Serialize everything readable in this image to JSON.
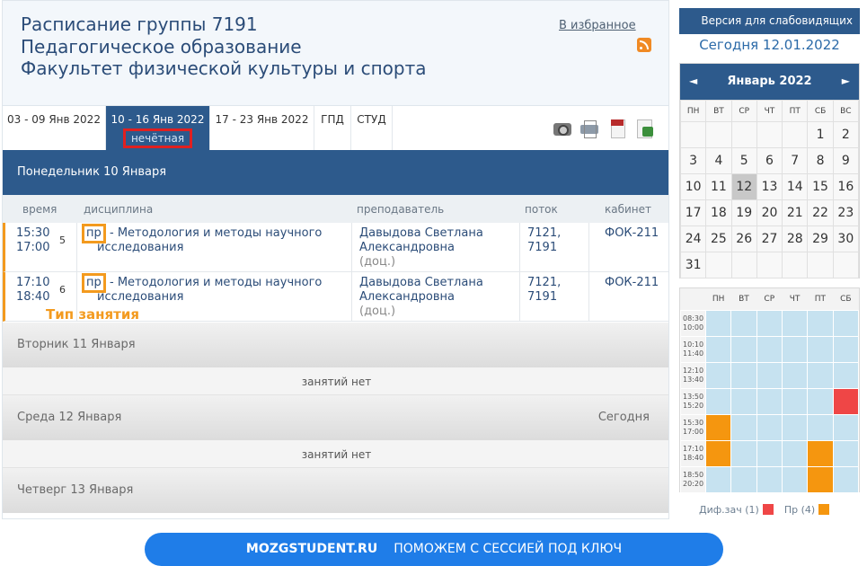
{
  "header": {
    "title_line1": "Расписание группы 7191",
    "title_line2": "Педагогическое образование",
    "title_line3": "Факультет физической культуры и спорта",
    "favorites_link": "В избранное"
  },
  "weeks": {
    "tabs": [
      {
        "label": "03 - 09 Янв 2022"
      },
      {
        "label": "10 - 16 Янв 2022"
      },
      {
        "label": "17 - 23 Янв 2022"
      },
      {
        "label": "ГПД"
      },
      {
        "label": "СТУД"
      }
    ],
    "active_parity": "нечётная"
  },
  "columns": {
    "time": "время",
    "discipline": "дисциплина",
    "teacher": "преподаватель",
    "stream": "поток",
    "room": "кабинет"
  },
  "days": {
    "monday": "Понедельник 10 Января",
    "tuesday": "Вторник 11 Января",
    "wednesday": "Среда 12 Января",
    "wednesday_today": "Сегодня",
    "thursday": "Четверг 13 Января",
    "no_lessons": "занятий нет"
  },
  "lessons": [
    {
      "start": "15:30",
      "end": "17:00",
      "num": "5",
      "type": "пр",
      "discipline": "- Методология и методы научного исследования",
      "teacher_line1": "Давыдова Светлана",
      "teacher_line2": "Александровна",
      "rank": "(доц.)",
      "stream_line1": "7121,",
      "stream_line2": "7191",
      "room": "ФОК-211"
    },
    {
      "start": "17:10",
      "end": "18:40",
      "num": "6",
      "type": "пр",
      "discipline": "- Методология и методы научного исследования",
      "teacher_line1": "Давыдова Светлана",
      "teacher_line2": "Александровна",
      "rank": "(доц.)",
      "stream_line1": "7121,",
      "stream_line2": "7191",
      "room": "ФОК-211"
    }
  ],
  "annotation": "Тип занятия",
  "sidebar": {
    "vision_button": "Версия для слабовидящих",
    "today": "Сегодня 12.01.2022",
    "calendar": {
      "month": "Январь 2022",
      "prev": "◄",
      "next": "►",
      "weekdays": [
        "ПН",
        "ВТ",
        "СР",
        "ЧТ",
        "ПТ",
        "СБ",
        "ВС"
      ],
      "today_day": "12",
      "weeks": [
        [
          "",
          "",
          "",
          "",
          "",
          "1",
          "2"
        ],
        [
          "3",
          "4",
          "5",
          "6",
          "7",
          "8",
          "9"
        ],
        [
          "10",
          "11",
          "12",
          "13",
          "14",
          "15",
          "16"
        ],
        [
          "17",
          "18",
          "19",
          "20",
          "21",
          "22",
          "23"
        ],
        [
          "24",
          "25",
          "26",
          "27",
          "28",
          "29",
          "30"
        ],
        [
          "31",
          "",
          "",
          "",
          "",
          "",
          ""
        ]
      ]
    },
    "week_grid": {
      "days": [
        "ПН",
        "ВТ",
        "СР",
        "ЧТ",
        "ПТ",
        "СБ"
      ],
      "slots": [
        {
          "from": "08:30",
          "to": "10:00",
          "cells": [
            "",
            "",
            "",
            "",
            "",
            ""
          ]
        },
        {
          "from": "10:10",
          "to": "11:40",
          "cells": [
            "",
            "",
            "",
            "",
            "",
            ""
          ]
        },
        {
          "from": "12:10",
          "to": "13:40",
          "cells": [
            "",
            "",
            "",
            "",
            "",
            ""
          ]
        },
        {
          "from": "13:50",
          "to": "15:20",
          "cells": [
            "",
            "",
            "",
            "",
            "",
            "dz"
          ]
        },
        {
          "from": "15:30",
          "to": "17:00",
          "cells": [
            "pr",
            "",
            "",
            "",
            "",
            ""
          ]
        },
        {
          "from": "17:10",
          "to": "18:40",
          "cells": [
            "pr",
            "",
            "",
            "",
            "pr",
            ""
          ]
        },
        {
          "from": "18:50",
          "to": "20:20",
          "cells": [
            "",
            "",
            "",
            "",
            "pr",
            ""
          ]
        }
      ],
      "legend": [
        {
          "label": "Диф.зач (1)",
          "color": "#ef4646"
        },
        {
          "label": "Пр (4)",
          "color": "#f5960f"
        }
      ]
    }
  },
  "banner": {
    "brand": "MOZGSTUDENT.RU",
    "text": "ПОМОЖЕМ С  СЕССИЕЙ ПОД КЛЮЧ"
  }
}
